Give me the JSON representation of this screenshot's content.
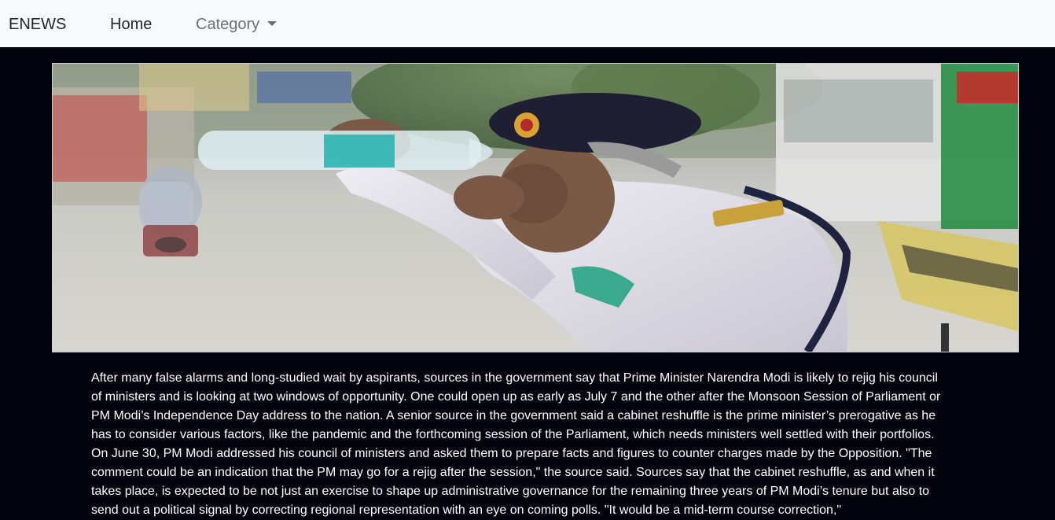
{
  "navbar": {
    "brand": "ENEWS",
    "home_label": "Home",
    "category_label": "Category"
  },
  "hero": {
    "icon": "news-photo-traffic-policeman-drinking-water"
  },
  "article": {
    "body": "After many false alarms and long-studied wait by aspirants, sources in the government say that Prime Minister Narendra Modi is likely to rejig his council of ministers and is looking at two windows of opportunity. One could open up as early as July 7 and the other after the Monsoon Session of Parliament or PM Modi’s Independence Day address to the nation. A senior source in the government said a cabinet reshuffle is the prime minister’s prerogative as he has to consider various factors, like the pandemic and the forthcoming session of the Parliament, which needs ministers well settled with their portfolios. On June 30, PM Modi addressed his council of ministers and asked them to prepare facts and figures to counter charges made by the Opposition. \"The comment could be an indication that the PM may go for a rejig after the session,\" the source said. Sources say that the cabinet reshuffle, as and when it takes place, is expected to be not just an exercise to shape up administrative governance for the remaining three years of PM Modi’s tenure but also to send out a political signal by correcting regional representation with an eye on coming polls. \"It would be a mid-term course correction,\""
  },
  "colors": {
    "page_background": "#02030d",
    "navbar_background": "#f8f9fa",
    "nav_text": "#212529",
    "nav_muted": "#6c6f73",
    "article_text": "#ffffff"
  }
}
